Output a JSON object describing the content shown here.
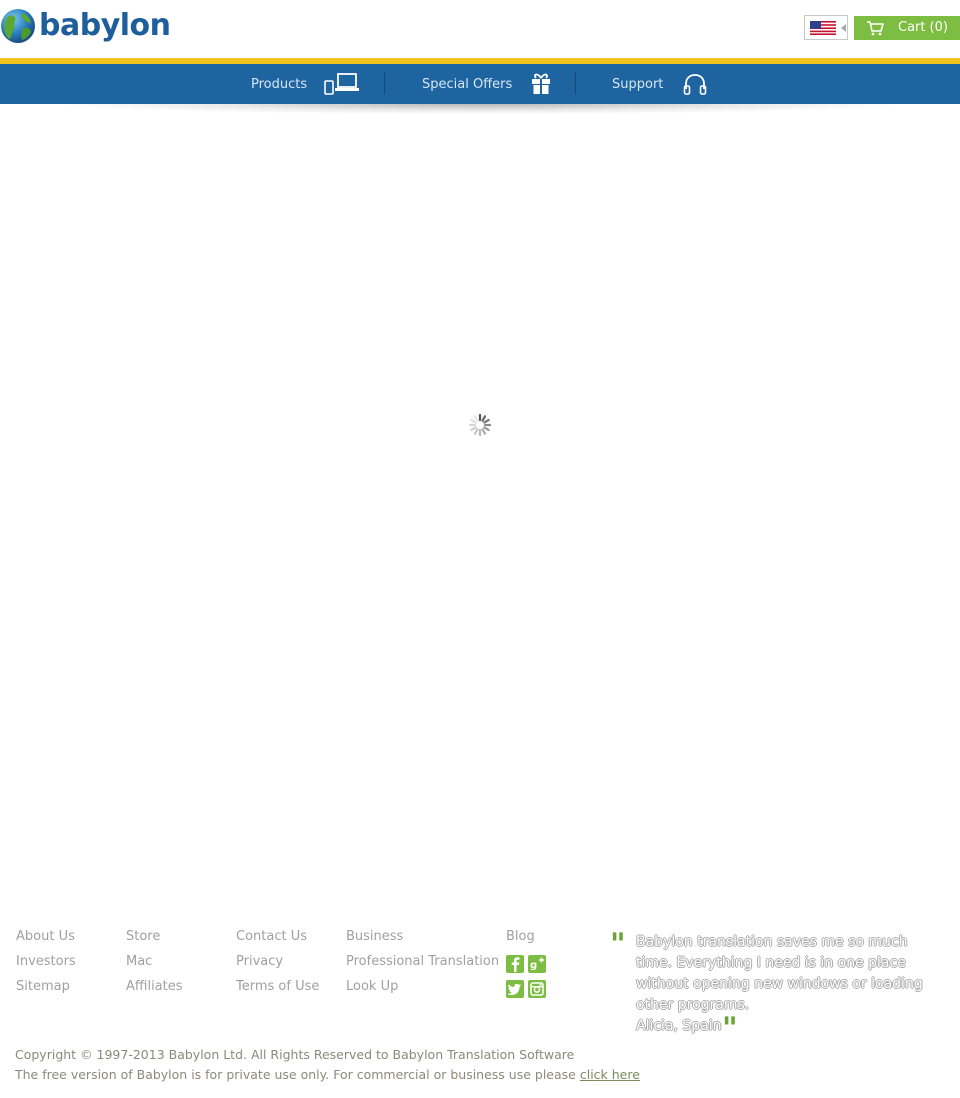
{
  "header": {
    "logo_text": "babylon",
    "language": "English (US)",
    "cart_label": "Cart",
    "cart_count": "(0)"
  },
  "nav": {
    "items": [
      {
        "label": "Products",
        "icon": "devices-icon"
      },
      {
        "label": "Special Offers",
        "icon": "gift-icon"
      },
      {
        "label": "Support",
        "icon": "headphones-icon"
      }
    ]
  },
  "footer": {
    "col1": [
      "About Us",
      "Investors",
      "Sitemap"
    ],
    "col2": [
      "Store",
      "Mac",
      "Affiliates"
    ],
    "col3": [
      "Contact Us",
      "Privacy",
      "Terms of Use"
    ],
    "col4": [
      "Business",
      "Professional Translation",
      "Look Up"
    ],
    "col5": [
      "Blog"
    ],
    "social": [
      "facebook-icon",
      "google-plus-icon",
      "twitter-icon",
      "instagram-icon"
    ],
    "testimonial": {
      "text": "Babylon translation saves me so much time. Everything I need is in one place without opening new windows or loading other programs.",
      "author": "Alicia, Spain"
    },
    "copyright": "Copyright © 1997-2013 Babylon Ltd. All Rights Reserved to Babylon Translation Software",
    "notice": "The free version of Babylon is for private use only. For commercial or business use please",
    "notice_link": "click here"
  },
  "colors": {
    "brand_blue": "#1e64a0",
    "accent_yellow": "#f1c21c",
    "accent_green": "#7dbd42"
  }
}
